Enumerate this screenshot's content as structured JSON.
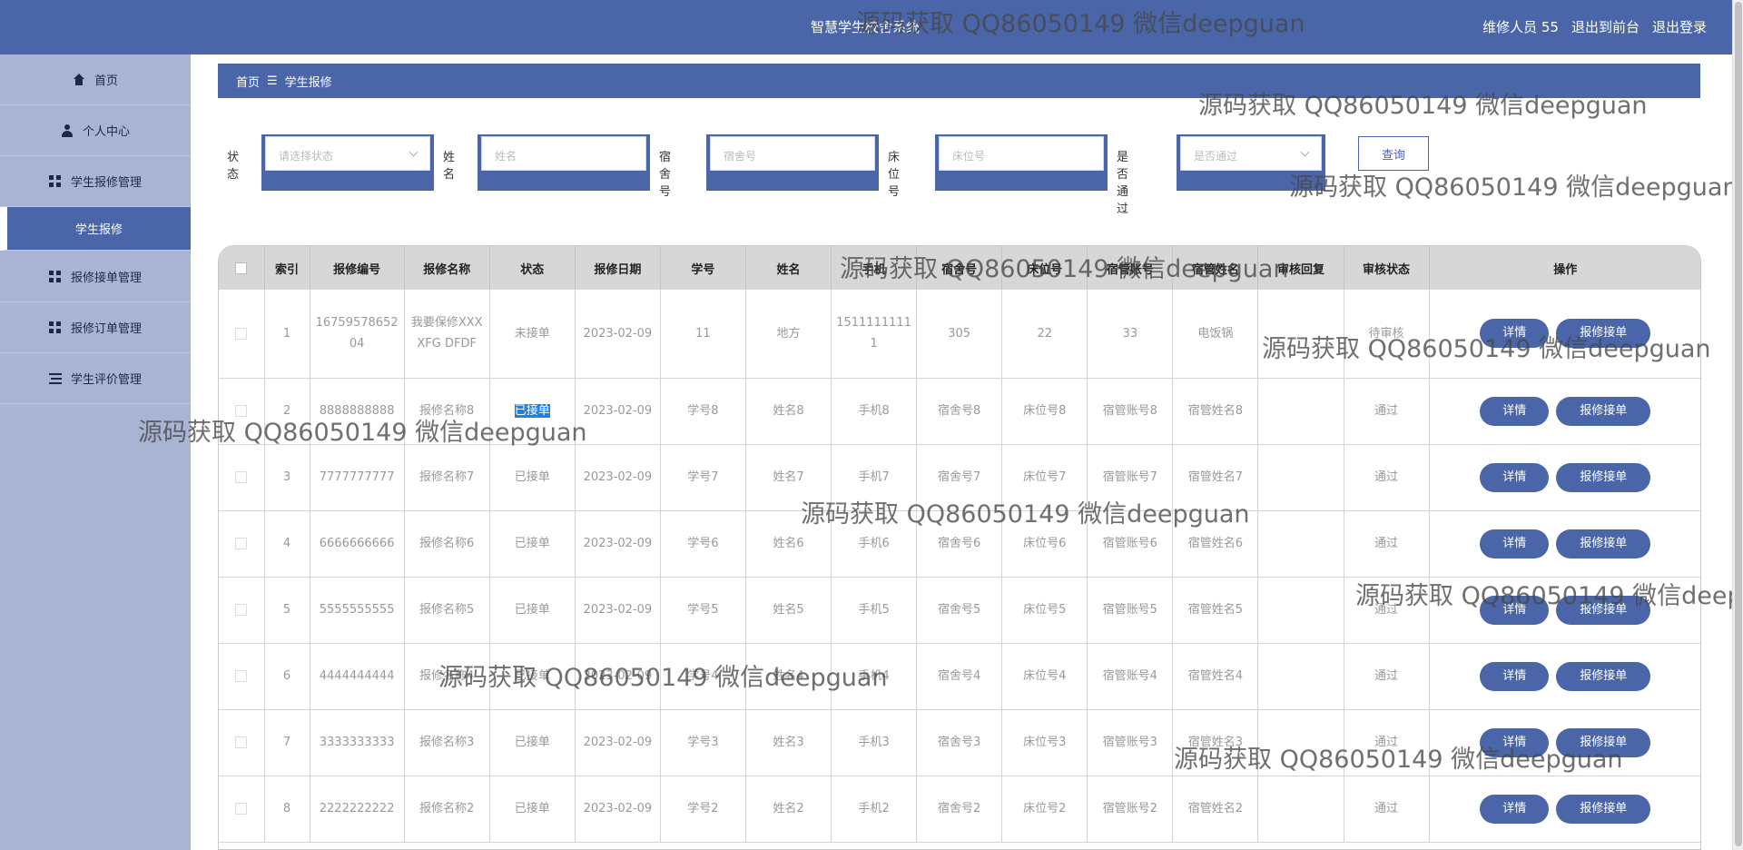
{
  "header": {
    "title": "智慧学生校舍系统",
    "user": "维修人员 55",
    "to_front": "退出到前台",
    "logout": "退出登录"
  },
  "sidebar": {
    "items": [
      {
        "label": "首页",
        "icon": "home-icon"
      },
      {
        "label": "个人中心",
        "icon": "user-icon"
      },
      {
        "label": "学生报修管理",
        "icon": "grid-icon"
      },
      {
        "label": "学生报修",
        "icon": ""
      },
      {
        "label": "报修接单管理",
        "icon": "grid-icon"
      },
      {
        "label": "报修订单管理",
        "icon": "grid-icon"
      },
      {
        "label": "学生评价管理",
        "icon": "list-icon"
      }
    ]
  },
  "breadcrumb": {
    "home": "首页",
    "sep": "☰",
    "current": "学生报修"
  },
  "search": {
    "status_label": "状态",
    "status_placeholder": "请选择状态",
    "name_label": "姓名",
    "name_placeholder": "姓名",
    "dorm_label": "宿舍号",
    "dorm_placeholder": "宿舍号",
    "bed_label": "床位号",
    "bed_placeholder": "床位号",
    "pass_label": "是否通过",
    "pass_placeholder": "是否通过",
    "query": "查询"
  },
  "table": {
    "columns": [
      "索引",
      "报修编号",
      "报修名称",
      "状态",
      "报修日期",
      "学号",
      "姓名",
      "手机",
      "宿舍号",
      "床位号",
      "宿管账号",
      "宿管姓名",
      "审核回复",
      "审核状态",
      "操作"
    ],
    "rows": [
      [
        "1",
        "1675957865204",
        "我要保修XXXXFG DFDF",
        "未接单",
        "2023-02-09",
        "11",
        "地方",
        "15111111111",
        "305",
        "22",
        "33",
        "电饭锅",
        "",
        "待审核"
      ],
      [
        "2",
        "8888888888",
        "报修名称8",
        "已接单",
        "2023-02-09",
        "学号8",
        "姓名8",
        "手机8",
        "宿舍号8",
        "床位号8",
        "宿管账号8",
        "宿管姓名8",
        "",
        "通过"
      ],
      [
        "3",
        "7777777777",
        "报修名称7",
        "已接单",
        "2023-02-09",
        "学号7",
        "姓名7",
        "手机7",
        "宿舍号7",
        "床位号7",
        "宿管账号7",
        "宿管姓名7",
        "",
        "通过"
      ],
      [
        "4",
        "6666666666",
        "报修名称6",
        "已接单",
        "2023-02-09",
        "学号6",
        "姓名6",
        "手机6",
        "宿舍号6",
        "床位号6",
        "宿管账号6",
        "宿管姓名6",
        "",
        "通过"
      ],
      [
        "5",
        "5555555555",
        "报修名称5",
        "已接单",
        "2023-02-09",
        "学号5",
        "姓名5",
        "手机5",
        "宿舍号5",
        "床位号5",
        "宿管账号5",
        "宿管姓名5",
        "",
        "通过"
      ],
      [
        "6",
        "4444444444",
        "报修名称4",
        "已接单",
        "2023-02-09",
        "学号4",
        "姓名4",
        "手机4",
        "宿舍号4",
        "床位号4",
        "宿管账号4",
        "宿管姓名4",
        "",
        "通过"
      ],
      [
        "7",
        "3333333333",
        "报修名称3",
        "已接单",
        "2023-02-09",
        "学号3",
        "姓名3",
        "手机3",
        "宿舍号3",
        "床位号3",
        "宿管账号3",
        "宿管姓名3",
        "",
        "通过"
      ],
      [
        "8",
        "2222222222",
        "报修名称2",
        "已接单",
        "2023-02-09",
        "学号2",
        "姓名2",
        "手机2",
        "宿舍号2",
        "床位号2",
        "宿管账号2",
        "宿管姓名2",
        "",
        "通过"
      ]
    ],
    "detail_label": "详情",
    "accept_label": "报修接单"
  },
  "watermark": "源码获取 QQ86050149 微信deepguan",
  "colors": {
    "primary": "#4a66a8",
    "sidebar": "#a9b4d4",
    "highlight": "#1e7fe6"
  }
}
